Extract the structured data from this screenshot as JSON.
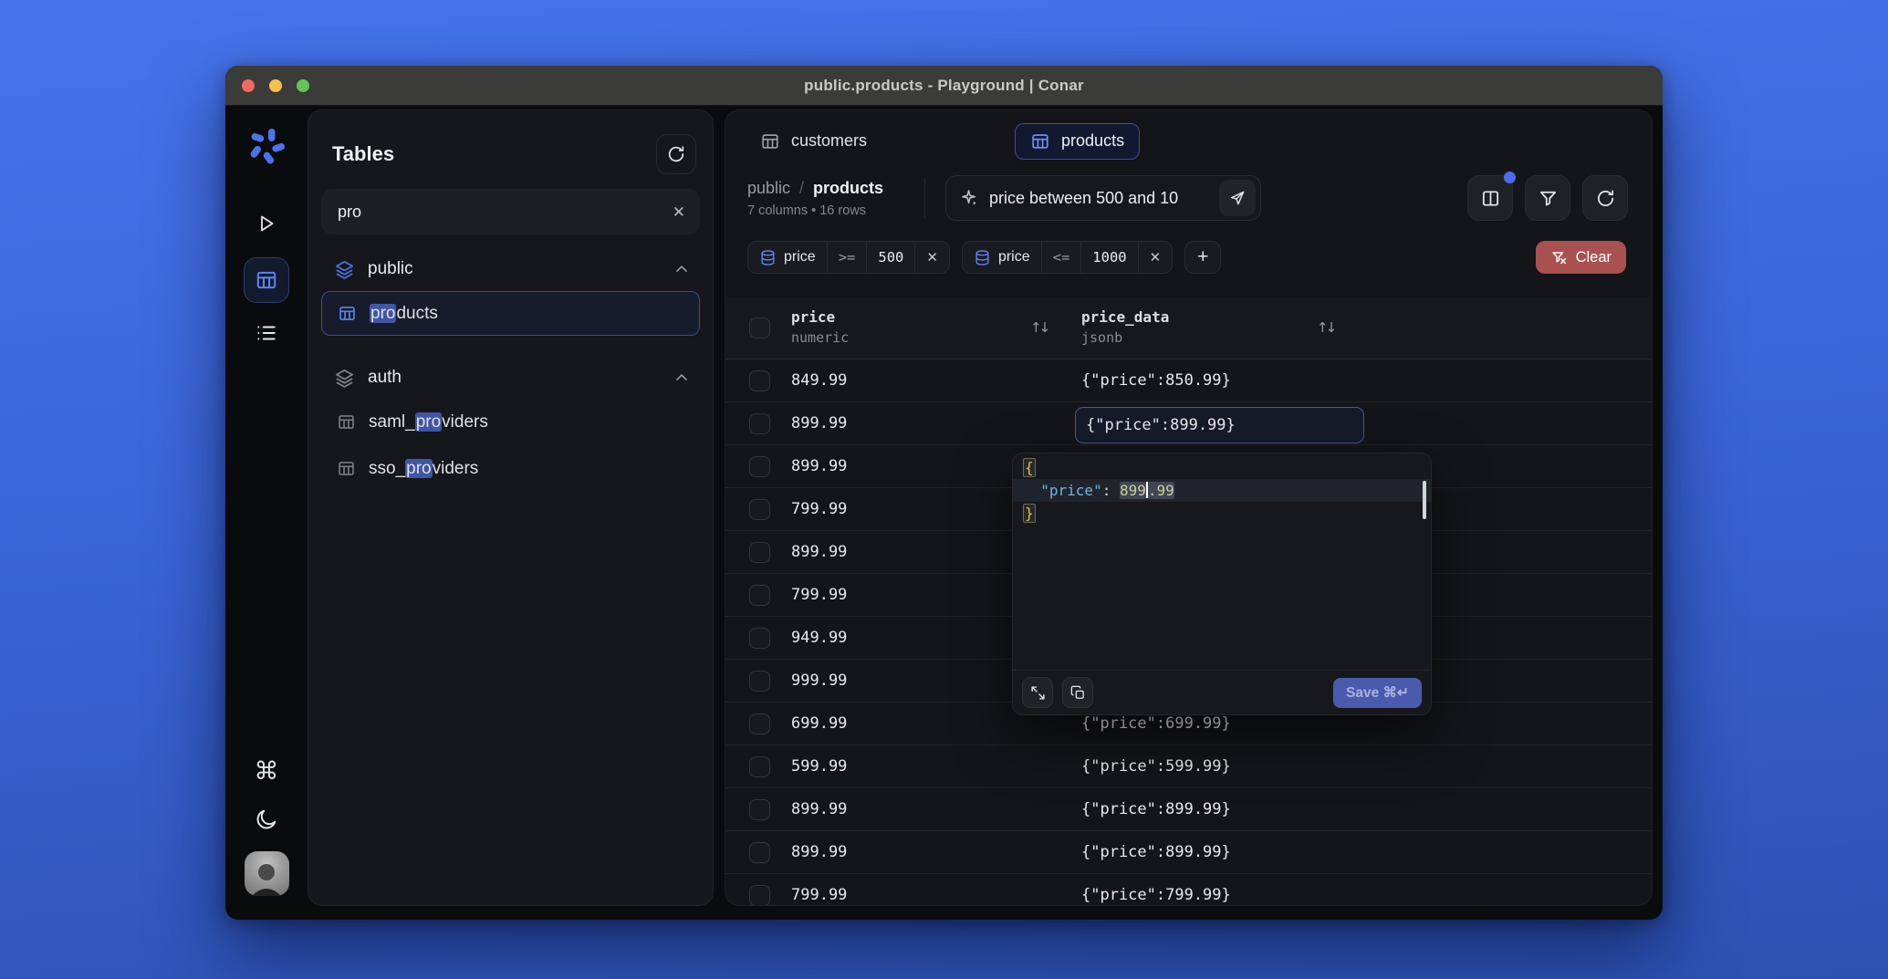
{
  "window": {
    "title": "public.products - Playground | Conar"
  },
  "colors": {
    "desktop_top": "#4674ec",
    "desktop_bottom": "#2b51b2",
    "accent_blue": "#5b82f0",
    "selection_blue": "#3f55a6",
    "clear_red": "#a85150",
    "save_blue": "#4a5aad",
    "editor_key": "#6fb3e2",
    "editor_number": "#c9d0a0",
    "editor_brace": "#d6c54a"
  },
  "icons": {
    "rail": [
      "conar-logo",
      "play",
      "table-grid",
      "list",
      "command",
      "moon",
      "avatar"
    ],
    "misc": [
      "refresh",
      "close",
      "layers",
      "chevron-up",
      "sparkles",
      "send",
      "columns",
      "funnel",
      "funnel-x",
      "database",
      "sort-arrows",
      "expand",
      "copy",
      "checkbox"
    ]
  },
  "sidebar": {
    "title": "Tables",
    "search": {
      "value": "pro"
    },
    "schemas": [
      {
        "name": "public",
        "icon_color": "#4c74e9",
        "tables": [
          {
            "pre": "",
            "match": "pro",
            "post": "ducts",
            "selected": true
          }
        ]
      },
      {
        "name": "auth",
        "icon_color": "#84858b",
        "tables": [
          {
            "pre": "saml_",
            "match": "pro",
            "post": "viders",
            "selected": false
          },
          {
            "pre": "sso_",
            "match": "pro",
            "post": "viders",
            "selected": false
          }
        ]
      }
    ]
  },
  "main": {
    "tabs": [
      {
        "label": "customers",
        "active": false
      },
      {
        "label": "products",
        "active": true
      }
    ],
    "breadcrumb": {
      "schema": "public",
      "separator": "/",
      "table": "products",
      "meta": "7 columns • 16 rows"
    },
    "ai_filter": {
      "value": "price between 500 and 10"
    },
    "filters": {
      "chips": [
        {
          "column": "price",
          "operator": ">=",
          "value": "500"
        },
        {
          "column": "price",
          "operator": "<=",
          "value": "1000"
        }
      ],
      "add_label": "+",
      "clear_label": "Clear"
    },
    "table": {
      "columns": [
        {
          "name": "price",
          "type": "numeric"
        },
        {
          "name": "price_data",
          "type": "jsonb"
        }
      ],
      "rows": [
        {
          "price": "849.99",
          "price_data": "{\"price\":850.99}",
          "cell_selected": false
        },
        {
          "price": "899.99",
          "price_data": "{\"price\":899.99}",
          "cell_selected": true
        },
        {
          "price": "899.99",
          "price_data": "",
          "cell_selected": false
        },
        {
          "price": "799.99",
          "price_data": "",
          "cell_selected": false
        },
        {
          "price": "899.99",
          "price_data": "",
          "cell_selected": false
        },
        {
          "price": "799.99",
          "price_data": "",
          "cell_selected": false
        },
        {
          "price": "949.99",
          "price_data": "",
          "cell_selected": false
        },
        {
          "price": "999.99",
          "price_data": "",
          "cell_selected": false
        },
        {
          "price": "699.99",
          "price_data": "{\"price\":699.99}",
          "cell_selected": false
        },
        {
          "price": "599.99",
          "price_data": "{\"price\":599.99}",
          "cell_selected": false
        },
        {
          "price": "899.99",
          "price_data": "{\"price\":899.99}",
          "cell_selected": false
        },
        {
          "price": "899.99",
          "price_data": "{\"price\":899.99}",
          "cell_selected": false
        },
        {
          "price": "799.99",
          "price_data": "{\"price\":799.99}",
          "cell_selected": false
        }
      ]
    },
    "editor": {
      "open_brace": "{",
      "indent": "  ",
      "key": "\"price\"",
      "colon": ": ",
      "num_a": "899",
      "num_b": ".99",
      "close_brace": "}",
      "save_label": "Save ⌘↵"
    }
  }
}
